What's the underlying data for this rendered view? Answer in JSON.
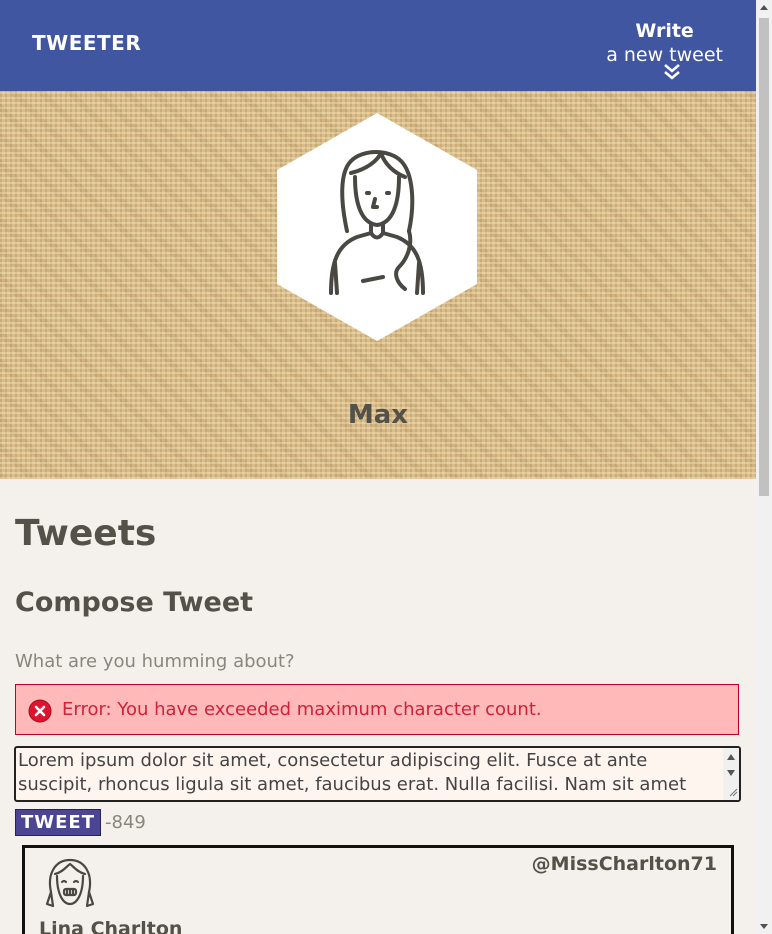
{
  "nav": {
    "brand": "TWEETER",
    "write_label_1": "Write",
    "write_label_2": "a new tweet",
    "icon": "double-chevron-down-icon"
  },
  "header": {
    "name": "Max",
    "avatar_icon": "user-avatar-icon"
  },
  "main": {
    "title": "Tweets",
    "compose_title": "Compose Tweet",
    "prompt": "What are you humming about?",
    "error": "Error: You have exceeded maximum character count.",
    "error_icon": "error-x-icon",
    "textarea_value": "Lorem ipsum dolor sit amet, consectetur adipiscing elit. Fusce at ante suscipit, rhoncus ligula sit amet, faucibus erat. Nulla facilisi. Nam sit amet maximus",
    "tweet_button": "TWEET",
    "counter": "-849"
  },
  "tweets": [
    {
      "name": "Lina Charlton",
      "handle": "@MissCharlton71",
      "avatar_icon": "smiling-girl-avatar-icon"
    }
  ],
  "colors": {
    "nav": "#4056a1",
    "background": "#f4f1ec",
    "header_texture": "#d9bd8a",
    "error_bg": "#ffb9b9",
    "error_text": "#d0213a",
    "button": "#4b4594"
  }
}
